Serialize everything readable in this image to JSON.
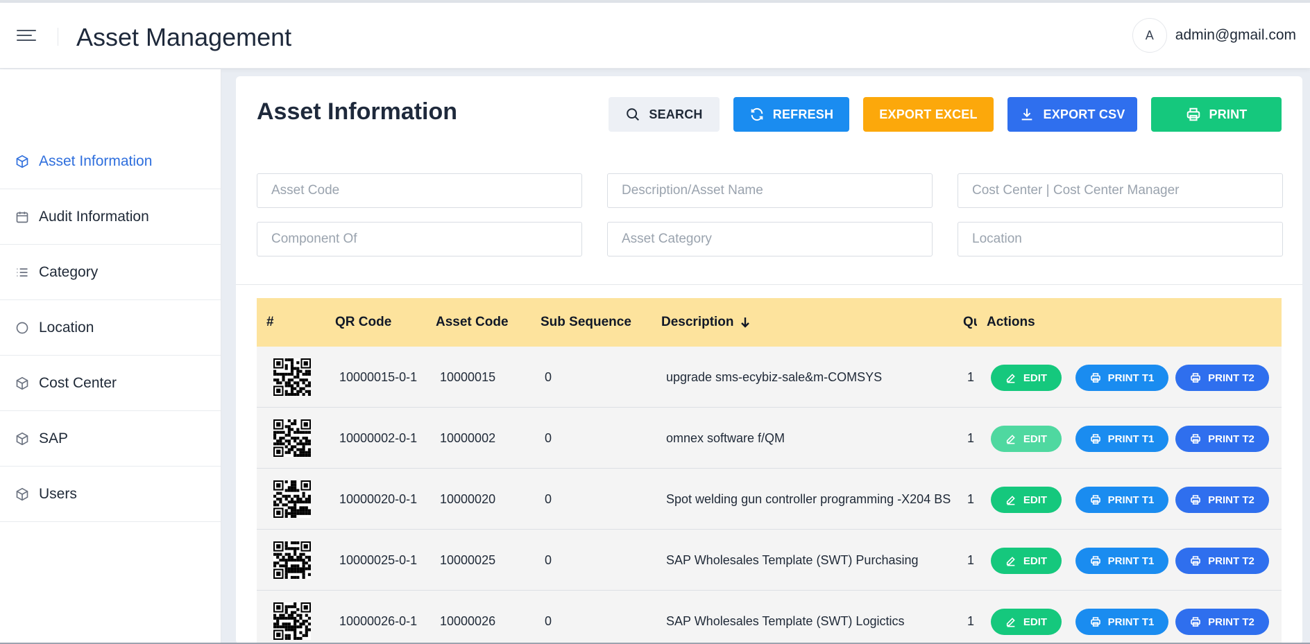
{
  "header": {
    "app_title": "Asset Management",
    "avatar_letter": "A",
    "user_email": "admin@gmail.com"
  },
  "sidebar": {
    "items": [
      {
        "label": "Asset Information",
        "icon": "cube-icon",
        "active": true
      },
      {
        "label": "Audit Information",
        "icon": "calendar-icon",
        "active": false
      },
      {
        "label": "Category",
        "icon": "list-icon",
        "active": false
      },
      {
        "label": "Location",
        "icon": "circle-icon",
        "active": false
      },
      {
        "label": "Cost Center",
        "icon": "cube-icon",
        "active": false
      },
      {
        "label": "SAP",
        "icon": "cube-icon",
        "active": false
      },
      {
        "label": "Users",
        "icon": "cube-icon",
        "active": false
      }
    ]
  },
  "main": {
    "title": "Asset Information",
    "toolbar": {
      "search_label": "SEARCH",
      "refresh_label": "REFRESH",
      "excel_label": "EXPORT EXCEL",
      "csv_label": "EXPORT CSV",
      "print_label": "PRINT"
    },
    "filters": {
      "asset_code": "Asset Code",
      "description": "Description/Asset Name",
      "cost_center": "Cost Center | Cost Center Manager",
      "component_of": "Component Of",
      "asset_category": "Asset Category",
      "location": "Location"
    },
    "table": {
      "headers": {
        "index": "#",
        "qr_code": "QR Code",
        "asset_code": "Asset Code",
        "sub_sequence": "Sub Sequence",
        "description": "Description",
        "qty": "Qu",
        "actions": "Actions"
      },
      "actions": {
        "edit": "EDIT",
        "print_t1": "PRINT T1",
        "print_t2": "PRINT T2"
      },
      "rows": [
        {
          "qr_code": "10000015-0-1",
          "asset_code": "10000015",
          "sub_sequence": "0",
          "description": "upgrade sms-ecybiz-sale&m-COMSYS",
          "qty": "1"
        },
        {
          "qr_code": "10000002-0-1",
          "asset_code": "10000002",
          "sub_sequence": "0",
          "description": "omnex software f/QM",
          "qty": "1"
        },
        {
          "qr_code": "10000020-0-1",
          "asset_code": "10000020",
          "sub_sequence": "0",
          "description": "Spot welding gun controller programming -X204 BS",
          "qty": "1"
        },
        {
          "qr_code": "10000025-0-1",
          "asset_code": "10000025",
          "sub_sequence": "0",
          "description": "SAP Wholesales Template (SWT) Purchasing",
          "qty": "1"
        },
        {
          "qr_code": "10000026-0-1",
          "asset_code": "10000026",
          "sub_sequence": "0",
          "description": "SAP Wholesales Template (SWT) Logictics",
          "qty": "1"
        }
      ]
    }
  },
  "colors": {
    "accent": "#2f6fdd",
    "refresh": "#1a8cf0",
    "excel": "#fca80b",
    "csv": "#2f6fee",
    "print": "#15c87d",
    "table_header": "#fde39d"
  }
}
